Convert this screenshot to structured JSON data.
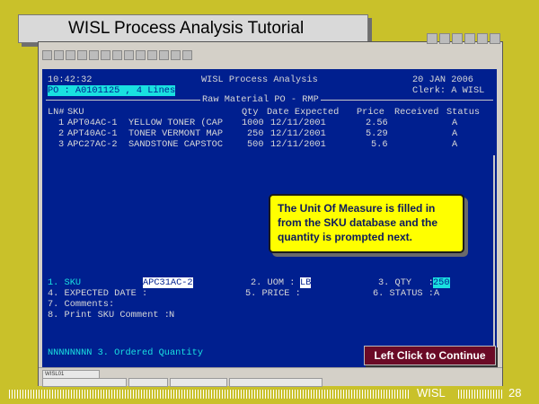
{
  "slide": {
    "title": "WISL Process Analysis Tutorial",
    "footer_brand": "WISL",
    "page_number": "28"
  },
  "terminal": {
    "time": "10:42:32",
    "app_title": "WISL Process Analysis",
    "date": "20 JAN 2006",
    "po_info": "PO : A0101125 , 4 Lines",
    "clerk": "Clerk: A WISL",
    "section_title": "Raw Material PO - RMP",
    "columns": {
      "ln": "LN#",
      "sku": "SKU",
      "qty": "Qty",
      "date_expected": "Date Expected",
      "price": "Price",
      "received": "Received",
      "status": "Status"
    },
    "lines": [
      {
        "ln": "1",
        "sku": "APT04AC-1",
        "desc": "YELLOW TONER (CAP",
        "qty": "1000",
        "date": "12/11/2001",
        "price": "2.56",
        "status": "A"
      },
      {
        "ln": "2",
        "sku": "APT40AC-1",
        "desc": "TONER VERMONT MAP",
        "qty": "250",
        "date": "12/11/2001",
        "price": "5.29",
        "status": "A"
      },
      {
        "ln": "3",
        "sku": "APC27AC-2",
        "desc": "SANDSTONE CAPSTOC",
        "qty": "500",
        "date": "12/11/2001",
        "price": "5.6",
        "status": "A"
      }
    ],
    "form": {
      "f1_label": "1. SKU",
      "f1_value": "APC31AC-2",
      "f2_label": "2. UOM :",
      "f2_value": "LB",
      "f3_label": "3. QTY   :",
      "f3_value": "250",
      "f4_label": "4. EXPECTED DATE :",
      "f5_label": "5. PRICE :",
      "f6_label": "6. STATUS :",
      "f6_value": "A",
      "f7_label": "7. Comments:",
      "f8_label": "8. Print SKU Comment :",
      "f8_value": "N"
    },
    "prompt": "NNNNNNNN 3. Ordered Quantity"
  },
  "callout_text": "The Unit Of Measure is filled in from the SKU database and the quantity is prompted next.",
  "continue_label": "Left Click to Continue",
  "status_bar": [
    "WISL01",
    "",
    "",
    "",
    ""
  ]
}
